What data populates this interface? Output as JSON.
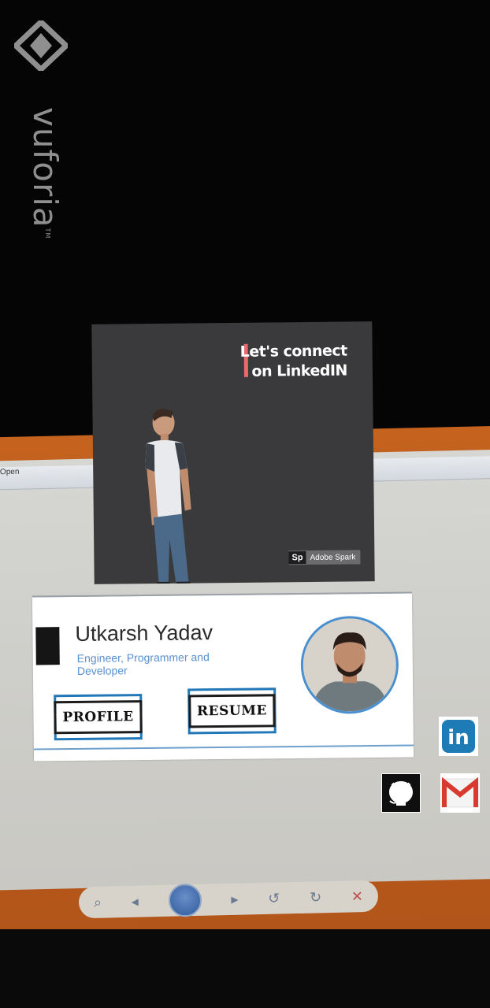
{
  "watermark": {
    "brand": "vuforia",
    "trademark": "TM"
  },
  "viewer": {
    "toolbar_open_label": "Open"
  },
  "poster": {
    "headline_line1": "Let's connect",
    "headline_line2": "on LinkedIN",
    "badge_logo": "Sp",
    "badge_text": "Adobe Spark",
    "accent_color": "#e86a6a"
  },
  "card": {
    "name": "Utkarsh Yadav",
    "subtitle": "Engineer, Programmer and Developer",
    "buttons": {
      "profile": "PROFILE",
      "resume": "RESUME"
    },
    "accent_color": "#2277b8"
  },
  "social": {
    "linkedin_label": "in",
    "icons": [
      "linkedin-icon",
      "github-icon",
      "gmail-icon"
    ]
  }
}
